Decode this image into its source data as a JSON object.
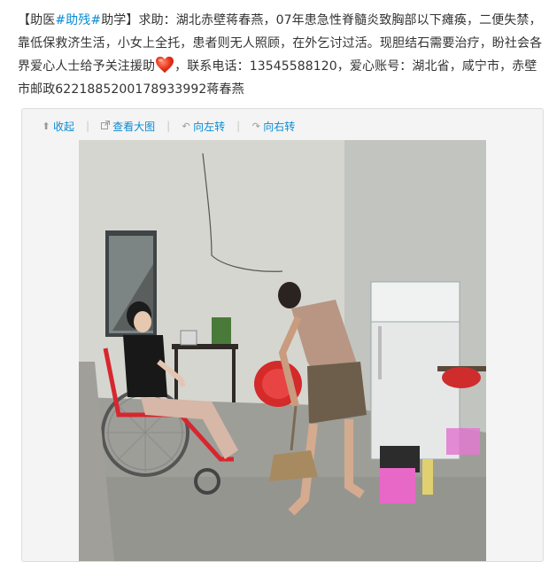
{
  "post": {
    "p0": "【助医",
    "tag1": "#助残#",
    "p1": "助学】求助：湖北赤壁蒋春燕，07年患急性脊髓炎致胸部以下瘫痪，二便失禁，靠低保救济生活，小女上全托，患者则无人照顾，在外乞讨过活。现胆结石需要治疗，盼社会各界爱心人士给予关注援助",
    "emoji": "heart-icon",
    "p2": "，联系电话：13545588120，爱心账号：湖北省，咸宁市，赤壁市邮政6221885200178933992蒋春燕"
  },
  "toolbar": {
    "collapse": "收起",
    "view_large": "查看大图",
    "rotate_left": "向左转",
    "rotate_right": "向右转",
    "icons": {
      "collapse": "arrow-up-icon",
      "view_large": "external-view-icon",
      "rotate_left": "rotate-left-icon",
      "rotate_right": "rotate-right-icon"
    }
  },
  "colors": {
    "link": "#0a8cd2",
    "text": "#333333",
    "box_bg": "#f4f4f4"
  }
}
